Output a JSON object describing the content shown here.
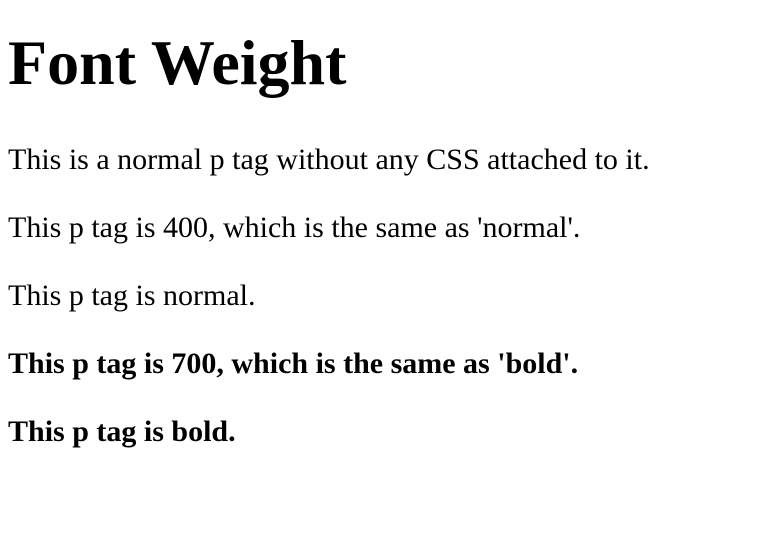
{
  "heading": "Font Weight",
  "paragraphs": [
    {
      "text": "This is a normal p tag without any CSS attached to it.",
      "weight": "default"
    },
    {
      "text": "This p tag is 400, which is the same as 'normal'.",
      "weight": "400"
    },
    {
      "text": "This p tag is normal.",
      "weight": "normal"
    },
    {
      "text": "This p tag is 700, which is the same as 'bold'.",
      "weight": "700"
    },
    {
      "text": "This p tag is bold.",
      "weight": "bold"
    }
  ]
}
